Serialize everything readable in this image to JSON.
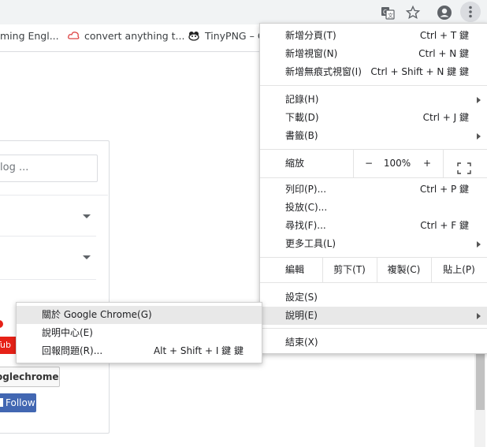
{
  "toolbar": {
    "icons": [
      "translate-icon",
      "star-icon",
      "profile-icon",
      "more-icon"
    ]
  },
  "bookmarks": [
    {
      "label": "ming Engl...",
      "icon": "bookmark-favicon"
    },
    {
      "label": "convert anything t...",
      "icon": "cloudconvert-icon"
    },
    {
      "label": "TinyPNG – C",
      "icon": "tinypng-icon"
    }
  ],
  "page": {
    "search_placeholder": "log ...",
    "youtube_label": "nTub",
    "googlechrome_button": "oglechrome",
    "follow_button": "Follow"
  },
  "main_menu": {
    "new_tab": {
      "label": "新增分頁(T)",
      "shortcut": "Ctrl + T 鍵"
    },
    "new_window": {
      "label": "新增視窗(N)",
      "shortcut": "Ctrl + N 鍵"
    },
    "new_incognito": {
      "label": "新增無痕式視窗(I)",
      "shortcut": "Ctrl + Shift + N 鍵 鍵"
    },
    "history": {
      "label": "記錄(H)"
    },
    "downloads": {
      "label": "下載(D)",
      "shortcut": "Ctrl + J 鍵"
    },
    "bookmarks": {
      "label": "書籤(B)"
    },
    "zoom": {
      "label": "縮放",
      "minus": "−",
      "value": "100%",
      "plus": "+"
    },
    "print": {
      "label": "列印(P)...",
      "shortcut": "Ctrl + P 鍵"
    },
    "cast": {
      "label": "投放(C)..."
    },
    "find": {
      "label": "尋找(F)...",
      "shortcut": "Ctrl + F 鍵"
    },
    "more_tools": {
      "label": "更多工具(L)"
    },
    "edit": {
      "label": "編輯",
      "cut": "剪下(T)",
      "copy": "複製(C)",
      "paste": "貼上(P)"
    },
    "settings": {
      "label": "設定(S)"
    },
    "help": {
      "label": "說明(E)"
    },
    "exit": {
      "label": "結束(X)"
    }
  },
  "help_submenu": {
    "about": {
      "label": "關於 Google Chrome(G)"
    },
    "help_center": {
      "label": "說明中心(E)"
    },
    "report_issue": {
      "label": "回報問題(R)...",
      "shortcut": "Alt + Shift + I 鍵 鍵"
    }
  },
  "colors": {
    "highlight": "#e8e8e8",
    "follow_blue": "#4267b2",
    "youtube_red": "#e62117"
  }
}
